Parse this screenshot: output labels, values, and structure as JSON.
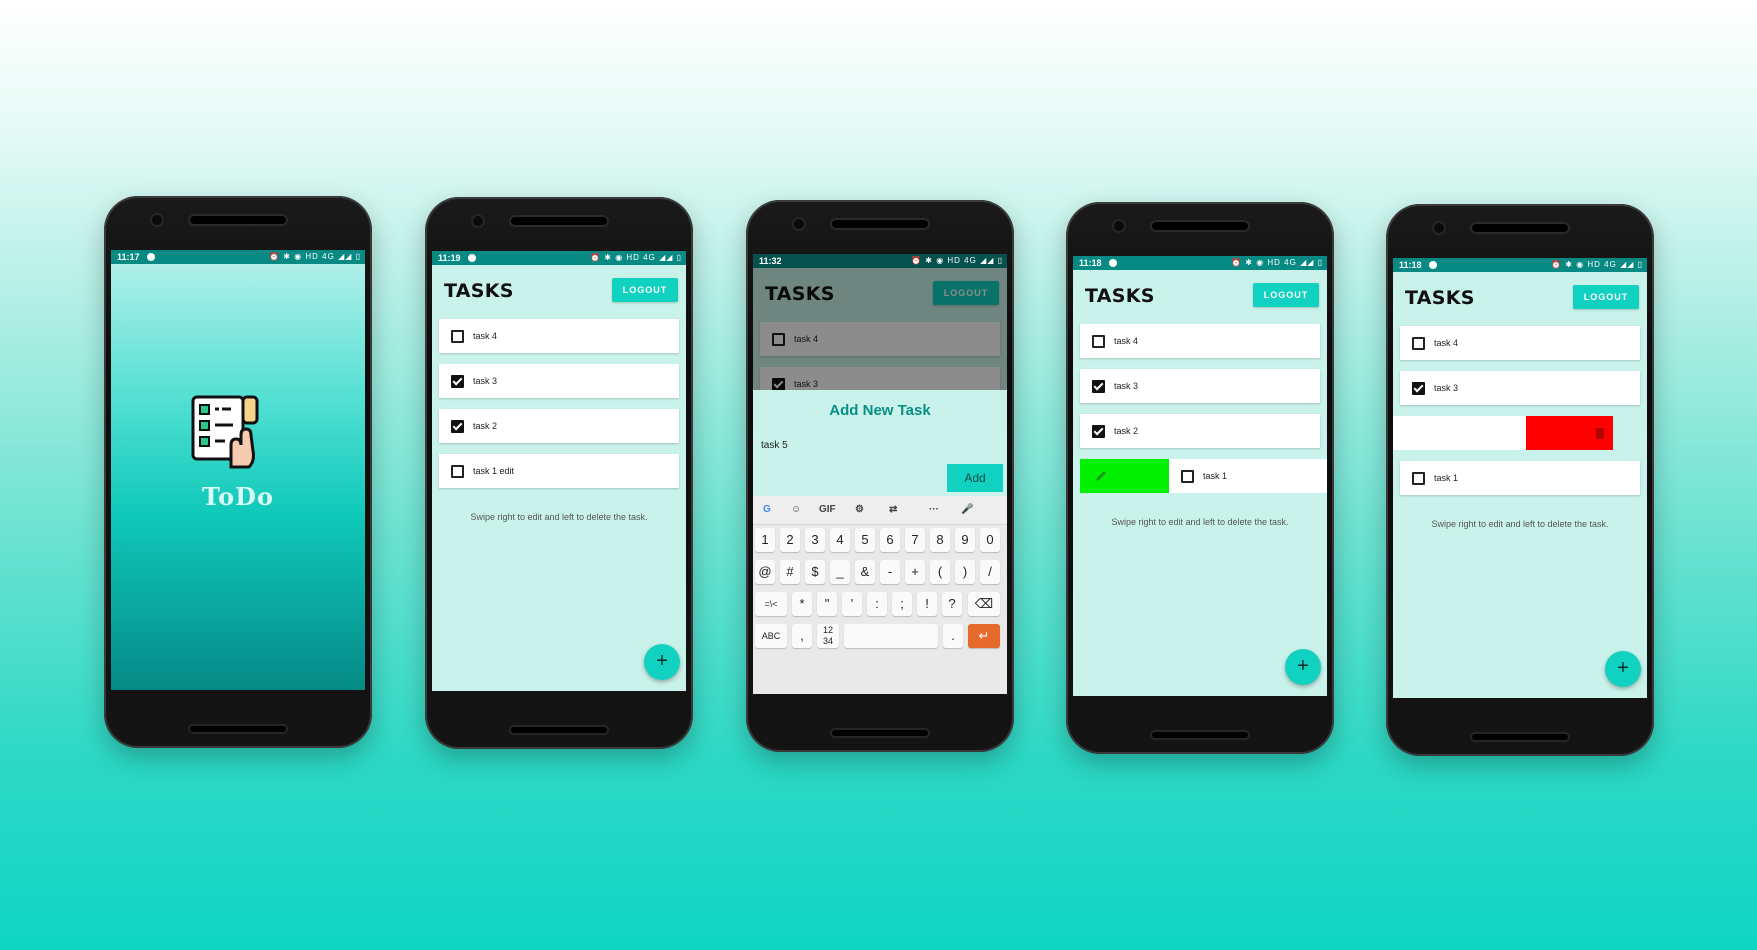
{
  "screens": {
    "splash": {
      "time": "11:17",
      "status_icons": "⏰ ✱ ◉ HD 4G ◢◢ ▯",
      "app_name": "ToDo",
      "logo_icon": "todo-checklist-logo"
    },
    "list": {
      "time": "11:19",
      "status_icons": "⏰ ✱ ◉ HD 4G ◢◢ ▯",
      "title": "TASKS",
      "logout_label": "LOGOUT",
      "tasks": [
        {
          "label": "task 4",
          "checked": false
        },
        {
          "label": "task 3",
          "checked": true
        },
        {
          "label": "task 2",
          "checked": true
        },
        {
          "label": "task 1 edit",
          "checked": false
        }
      ],
      "hint": "Swipe right to edit and left to delete the task.",
      "fab_label": "+"
    },
    "add_dialog": {
      "time": "11:32",
      "status_icons": "⏰ ✱ ◉ HD 4G ◢◢ ▯",
      "title": "TASKS",
      "logout_label": "LOGOUT",
      "tasks": [
        {
          "label": "task 4",
          "checked": false
        },
        {
          "label": "task 3",
          "checked": true
        }
      ],
      "dialog_title": "Add New Task",
      "input_value": "task 5",
      "add_label": "Add",
      "keyboard": {
        "toolbar": [
          "G",
          "☺",
          "GIF",
          "⚙",
          "⇄",
          "···",
          "🎤"
        ],
        "row1": [
          "1",
          "2",
          "3",
          "4",
          "5",
          "6",
          "7",
          "8",
          "9",
          "0"
        ],
        "row2": [
          "@",
          "#",
          "$",
          "_",
          "&",
          "-",
          "+",
          "(",
          ")",
          "/"
        ],
        "row3": [
          "=\\<",
          "*",
          "\"",
          "'",
          ":",
          ";",
          "!",
          "?",
          "⌫"
        ],
        "row4": [
          "ABC",
          ",",
          "12 34",
          " ",
          ".",
          "↵"
        ]
      }
    },
    "edit_swipe": {
      "time": "11:18",
      "status_icons": "⏰ ✱ ◉ HD 4G ◢◢ ▯",
      "title": "TASKS",
      "logout_label": "LOGOUT",
      "tasks": [
        {
          "label": "task 4",
          "checked": false
        },
        {
          "label": "task 3",
          "checked": true
        },
        {
          "label": "task 2",
          "checked": true
        },
        {
          "label": "task 1",
          "checked": false
        }
      ],
      "swipe_color": "#00f000",
      "swipe_icon": "pencil-icon",
      "hint": "Swipe right to edit and left to delete the task.",
      "fab_label": "+"
    },
    "delete_swipe": {
      "time": "11:18",
      "status_icons": "⏰ ✱ ◉ HD 4G ◢◢ ▯",
      "title": "TASKS",
      "logout_label": "LOGOUT",
      "tasks": [
        {
          "label": "task 4",
          "checked": false
        },
        {
          "label": "task 3",
          "checked": true
        },
        {
          "label": "task 1",
          "checked": false
        }
      ],
      "swipe_color": "#ff0000",
      "swipe_icon": "trash-icon",
      "hint": "Swipe right to edit and left to delete the task.",
      "fab_label": "+"
    }
  },
  "colors": {
    "accent": "#11d2c0",
    "status_bar": "#078a83",
    "screen_bg": "#c9f2ea",
    "dialog_title": "#0a8f86"
  }
}
